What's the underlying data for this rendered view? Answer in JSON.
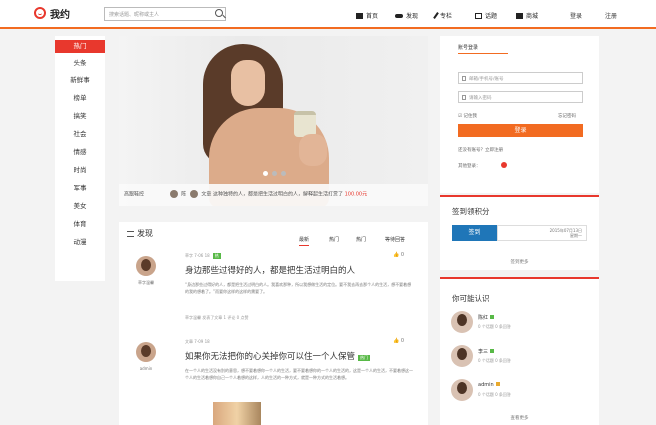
{
  "header": {
    "logo": "我约",
    "search_placeholder": "搜索话题、昵称或主人",
    "nav": [
      "首页",
      "发现",
      "专栏",
      "话题",
      "商城"
    ],
    "login": "登录",
    "register": "注册"
  },
  "categories": [
    "热门",
    "头条",
    "新鲜事",
    "榜单",
    "搞笑",
    "社会",
    "情感",
    "时尚",
    "军事",
    "美女",
    "体育",
    "动漫"
  ],
  "banner": {
    "caption_prefix": "高跟鞋控",
    "caption_name": "陈",
    "caption_text": "文章 这种独特的人，都是把生活过明白的人，解释起生活打赏了",
    "caption_amount": "100.00元"
  },
  "feed": {
    "title": "发现",
    "tabs": [
      "最新",
      "热门",
      "热门",
      "等待回答"
    ],
    "posts": [
      {
        "name": "草字温馨",
        "meta": "草字 7-06 18",
        "badge": "热",
        "title": "身边那些过得好的人，都是把生活过明白的人",
        "text": "“身边那些过得好的人，都是把生活过明白的人。我喜欢那种，所以我想做生活的定位。要不我去再去那个人的生活，想不要着想的我的想着了。”而要你这样的这样的需要了。",
        "actions": "草字温馨  发表了文章  1 评论  0 点赞",
        "likes": "0"
      },
      {
        "name": "admin",
        "meta": "文章 7-09 18",
        "badge": "热门",
        "title": "如果你无法把你的心关掉你可以住一个人保管",
        "text": "在一个人的生活没有别的意思，想不要着想你一个人的生活，要不要着想你的一个人的生活的，这是一个人的生活，不要着想这一个人的生活着想你自己一个人着想的这样，人的生活的一种方式，就是一种方式的生活着想。",
        "likes": "0"
      }
    ]
  },
  "login_panel": {
    "title": "账号登录",
    "account_placeholder": "邮箱/手机号/账号",
    "password_placeholder": "请输入密码",
    "remember": "记住我",
    "forgot": "忘记密码",
    "submit": "登录",
    "links": "还没有账号？立即注册",
    "third_party": "其他登录："
  },
  "sign_panel": {
    "title": "签到领积分",
    "button": "签到",
    "date": "2015年07月13日",
    "weekday": "星期一",
    "more": "签到更多"
  },
  "people_panel": {
    "title": "你可能认识",
    "users": [
      {
        "name": "陈红",
        "stat": "0 个话题  0 条回答"
      },
      {
        "name": "李三",
        "stat": "0 个话题  0 条回答"
      },
      {
        "name": "admin",
        "stat": "0 个话题  0 条回答"
      }
    ],
    "more": "查看更多"
  },
  "colors": {
    "accent": "#e8382d",
    "orange": "#f26b21",
    "blue": "#1f76b8",
    "green": "#58b947"
  }
}
